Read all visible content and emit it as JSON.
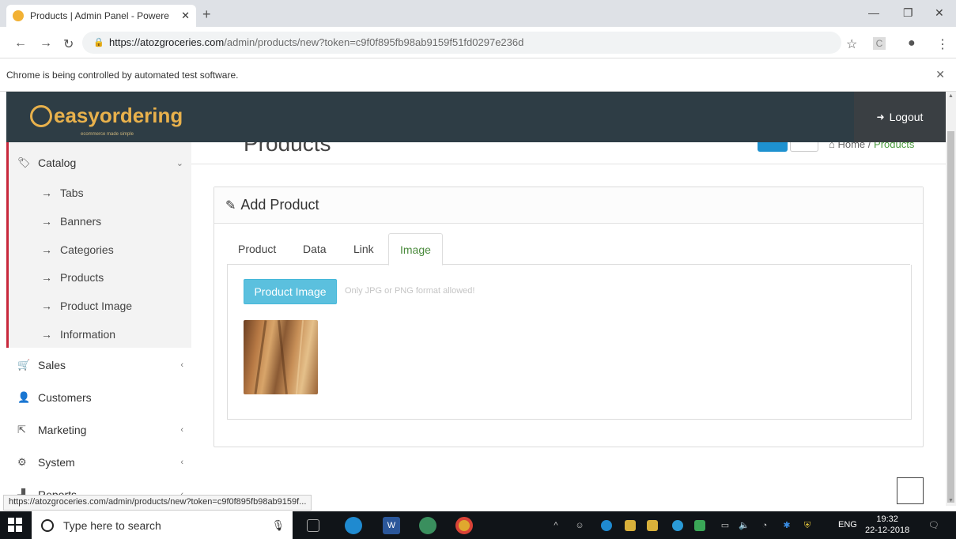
{
  "browser": {
    "tab_title": "Products | Admin Panel - Powere",
    "url_host": "https://atozgroceries.com",
    "url_path": "/admin/products/new?token=c9f0f895fb98ab9159f51fd0297e236d",
    "infobar": "Chrome is being controlled by automated test software.",
    "status_url": "https://atozgroceries.com/admin/products/new?token=c9f0f895fb98ab9159f..."
  },
  "header": {
    "logo": "easyordering",
    "logo_tagline": "ecommerce made simple",
    "logout": "Logout"
  },
  "page": {
    "title": "Products",
    "breadcrumb_home": "Home",
    "breadcrumb_sep": "/",
    "breadcrumb_current": "Products"
  },
  "sidebar": {
    "catalog": "Catalog",
    "sub_items": [
      "Tabs",
      "Banners",
      "Categories",
      "Products",
      "Product Image",
      "Information"
    ],
    "sales": "Sales",
    "customers": "Customers",
    "marketing": "Marketing",
    "system": "System",
    "reports": "Reports"
  },
  "panel": {
    "heading": "Add Product",
    "tabs": [
      "Product",
      "Data",
      "Link",
      "Image"
    ],
    "active_tab": "Image",
    "image_button": "Product Image",
    "image_hint": "Only JPG or PNG format allowed!"
  },
  "taskbar": {
    "search_placeholder": "Type here to search",
    "lang": "ENG",
    "time": "19:32",
    "date": "22-12-2018"
  },
  "colors": {
    "header_bg": "#2e3d45",
    "brand": "#e8b14c",
    "catalog_accent": "#c8283c",
    "button_info": "#5bc0de",
    "active_tab_text": "#4a8a3c"
  }
}
